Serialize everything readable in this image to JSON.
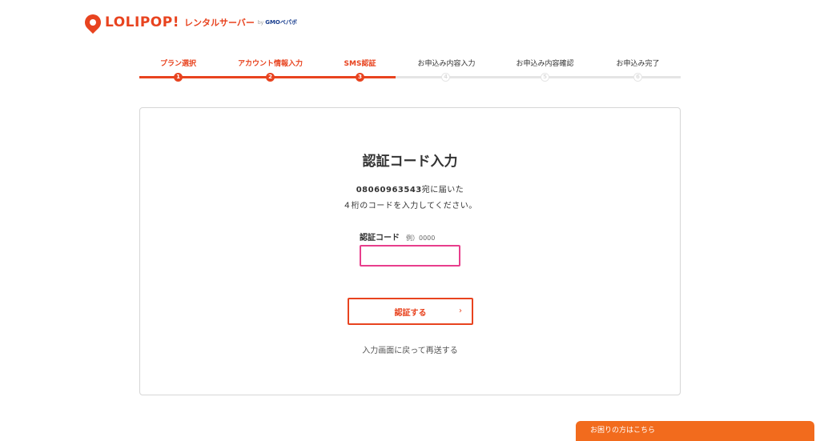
{
  "header": {
    "brand": "LOLIPOP!",
    "brand_sub": "レンタルサーバー",
    "by": "by",
    "gmo": "GMOペパボ"
  },
  "stepper": {
    "steps": [
      {
        "label": "プラン選択",
        "number": "1",
        "status": "done"
      },
      {
        "label": "アカウント情報入力",
        "number": "2",
        "status": "done"
      },
      {
        "label": "SMS認証",
        "number": "3",
        "status": "current"
      },
      {
        "label": "お申込み内容入力",
        "number": "4",
        "status": "todo"
      },
      {
        "label": "お申込み内容確認",
        "number": "5",
        "status": "todo"
      },
      {
        "label": "お申込み完了",
        "number": "6",
        "status": "todo"
      }
    ],
    "current_step": 3,
    "total_steps": 6
  },
  "card": {
    "title": "認証コード入力",
    "phone": "08060963543",
    "desc1_suffix": "宛に届いた",
    "desc2": "４桁のコードを入力してください。",
    "field_label": "認証コード",
    "field_example": "例）0000",
    "field_value": "",
    "submit_label": "認証する",
    "submit_chevron": "›",
    "back_link": "入力画面に戻って再送する"
  },
  "help": {
    "label": "お困りの方はこちら"
  },
  "colors": {
    "accent": "#e8431f",
    "input_focus": "#e83e8c",
    "help_tab": "#f26b1d",
    "inactive_track": "#e5e5e5"
  }
}
